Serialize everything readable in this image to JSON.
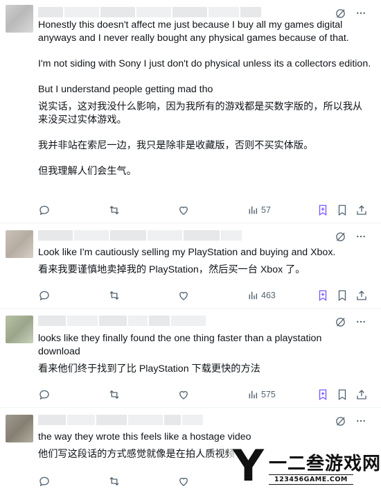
{
  "posts": [
    {
      "paragraphs_en": [
        "Honestly this doesn't affect me just because I buy all my games digital anyways and I never really bought any physical games because of that.",
        "I'm not siding with Sony I just don't do physical unless its a collectors edition.",
        "But I understand people getting mad tho"
      ],
      "paragraphs_zh": [
        "说实话，这对我没什么影响，因为我所有的游戏都是买数字版的，所以我从来没买过实体游戏。",
        "我并非站在索尼一边，我只是除非是收藏版，否则不买实体版。",
        "但我理解人们会生气。"
      ],
      "views": "57"
    },
    {
      "paragraphs_en": [
        "Look like I'm cautiously selling my PlayStation and buying and Xbox."
      ],
      "paragraphs_zh": [
        "看来我要谨慎地卖掉我的 PlayStation，然后买一台 Xbox 了。"
      ],
      "views": "463"
    },
    {
      "paragraphs_en": [
        "looks like they finally found the one thing faster than a playstation download"
      ],
      "paragraphs_zh": [
        "看来他们终于找到了比 PlayStation 下载更快的方法"
      ],
      "views": "575"
    },
    {
      "paragraphs_en": [
        "the way they wrote this feels like a hostage video"
      ],
      "paragraphs_zh": [
        "他们写这段话的方式感觉就像是在拍人质视频"
      ],
      "views": ""
    }
  ],
  "icons": {
    "top": [
      "grok-icon",
      "more-icon"
    ],
    "actions": [
      "reply-icon",
      "repost-icon",
      "like-icon",
      "views-icon",
      "bookmark-plus-icon",
      "bookmark-icon",
      "share-icon"
    ]
  },
  "watermark": {
    "logo_letter": "Y",
    "brand": "一二叁游戏网",
    "site": "123456GAME.COM"
  },
  "colors": {
    "text": "#0f1419",
    "icon": "#536471",
    "accent": "#7856ff",
    "divider": "#eff3f4"
  }
}
